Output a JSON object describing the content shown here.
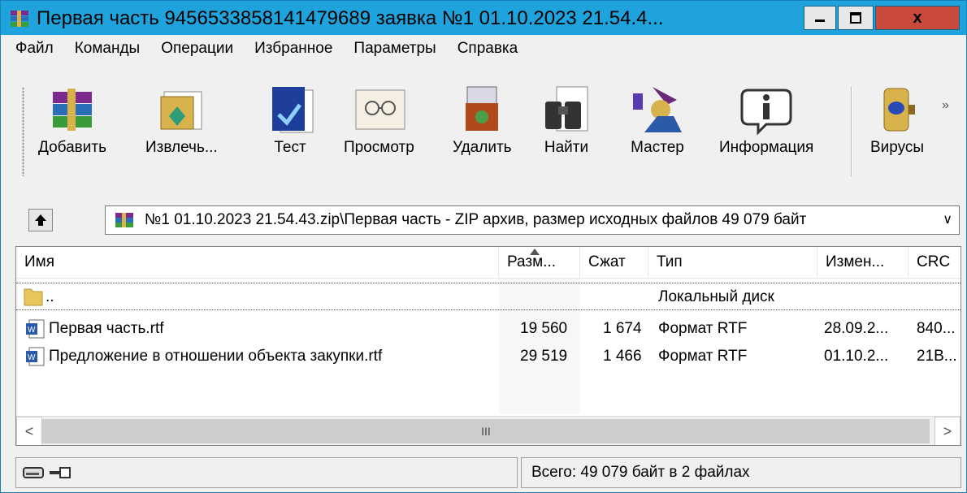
{
  "window": {
    "title": "Первая часть 9456533858141479689 заявка №1 01.10.2023 21.54.4...",
    "close_label": "x"
  },
  "menu": [
    "Файл",
    "Команды",
    "Операции",
    "Избранное",
    "Параметры",
    "Справка"
  ],
  "toolbar": {
    "add": "Добавить",
    "extract": "Извлечь...",
    "test": "Тест",
    "view": "Просмотр",
    "delete": "Удалить",
    "find": "Найти",
    "wizard": "Мастер",
    "info": "Информация",
    "virus": "Вирусы",
    "more": "»"
  },
  "address": {
    "path": "№1 01.10.2023 21.54.43.zip\\Первая часть - ZIP архив, размер исходных файлов 49 079 байт",
    "dropdown": "∨"
  },
  "columns": {
    "name": "Имя",
    "size": "Разм...",
    "packed": "Сжат",
    "type": "Тип",
    "modified": "Измен...",
    "crc": "CRC"
  },
  "rows": [
    {
      "name": "..",
      "size": "",
      "packed": "",
      "type": "Локальный диск",
      "modified": "",
      "crc": ""
    },
    {
      "name": "Первая часть.rtf",
      "size": "19 560",
      "packed": "1 674",
      "type": "Формат RTF",
      "modified": "28.09.2...",
      "crc": "840..."
    },
    {
      "name": "Предложение в отношении объекта закупки.rtf",
      "size": "29 519",
      "packed": "1 466",
      "type": "Формат RTF",
      "modified": "01.10.2...",
      "crc": "21B..."
    }
  ],
  "scroll": {
    "thumb_mark": "III",
    "left": "<",
    "right": ">"
  },
  "status": {
    "total": "Всего: 49 079 байт в 2 файлах"
  }
}
